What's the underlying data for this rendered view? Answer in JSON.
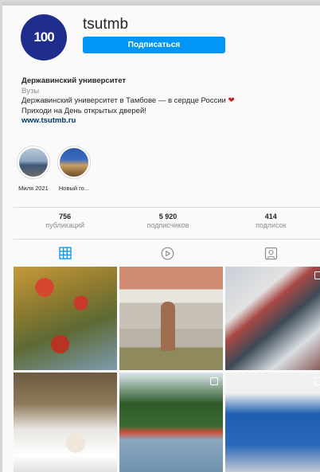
{
  "profile": {
    "username": "tsutmb",
    "avatar_text": "100",
    "follow_label": "Подписаться"
  },
  "bio": {
    "name": "Державинский университет",
    "category": "Вузы",
    "line1": "Державинский университет в Тамбове — в сердце России",
    "line2": "Приходи на День открытых дверей!",
    "link": "www.tsutmb.ru"
  },
  "highlights": [
    {
      "label": "Миля 2021"
    },
    {
      "label": "Новый го..."
    }
  ],
  "stats": [
    {
      "count": "756",
      "label": "публикаций"
    },
    {
      "count": "5 920",
      "label": "подписчиков"
    },
    {
      "count": "414",
      "label": "подписок"
    }
  ],
  "colors": {
    "accent": "#0095f6",
    "avatar_bg": "#1f2d8c",
    "link": "#00376b",
    "muted": "#8e8e8e"
  },
  "tabs": [
    {
      "icon": "grid-icon",
      "active": true
    },
    {
      "icon": "play-circle-icon",
      "active": false
    },
    {
      "icon": "tagged-person-icon",
      "active": false
    }
  ]
}
